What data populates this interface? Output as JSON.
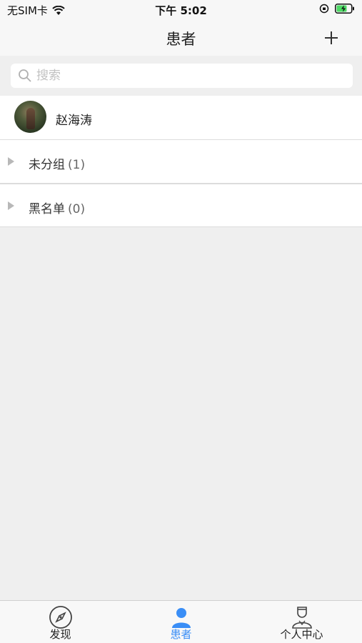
{
  "status_bar": {
    "carrier": "无SIM卡",
    "time": "下午 5:02"
  },
  "nav": {
    "title": "患者",
    "add_icon": "plus-icon"
  },
  "search": {
    "placeholder": "搜索",
    "icon": "search-icon"
  },
  "patients": [
    {
      "name": "赵海涛"
    }
  ],
  "groups": [
    {
      "label": "未分组",
      "count": "(1)"
    },
    {
      "label": "黑名单",
      "count": "(0)"
    }
  ],
  "tabs": [
    {
      "label": "发现",
      "icon": "compass-icon",
      "active": false
    },
    {
      "label": "患者",
      "icon": "person-icon",
      "active": true
    },
    {
      "label": "个人中心",
      "icon": "doctor-icon",
      "active": false
    }
  ],
  "colors": {
    "accent": "#3a8ef6",
    "background": "#efefef"
  }
}
